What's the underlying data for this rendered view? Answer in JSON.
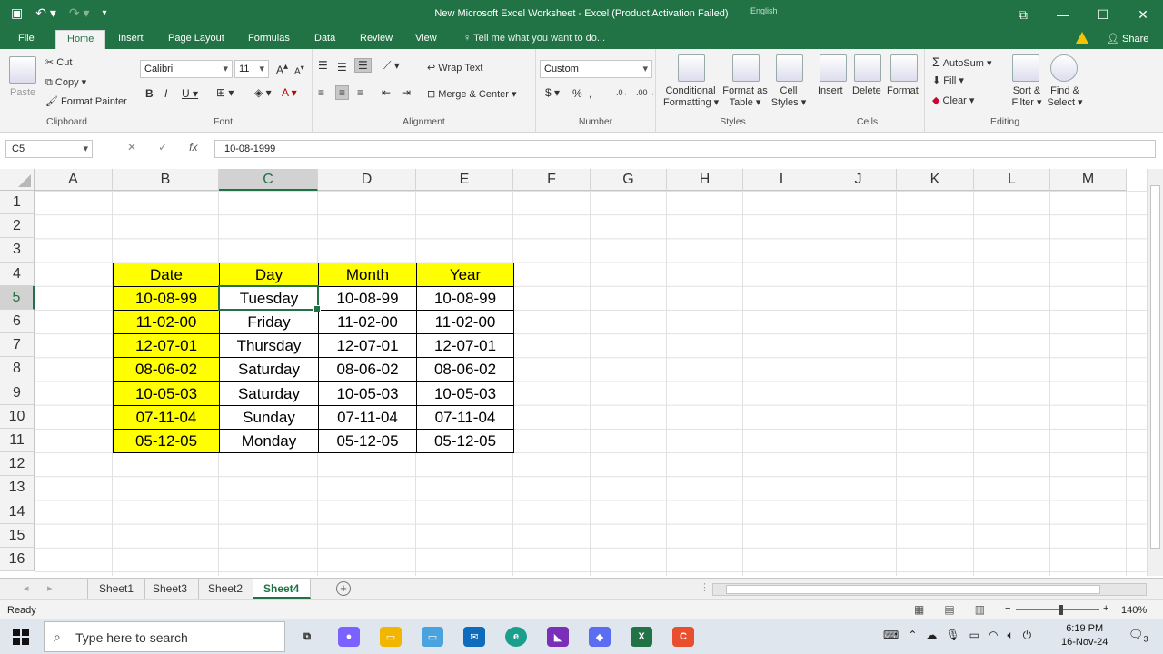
{
  "title": "New Microsoft Excel Worksheet - Excel (Product Activation Failed)",
  "language": "English",
  "ribbon_tabs": [
    "File",
    "Home",
    "Insert",
    "Page Layout",
    "Formulas",
    "Data",
    "Review",
    "View"
  ],
  "tell_me": "Tell me what you want to do...",
  "share": "Share",
  "clipboard": {
    "paste": "Paste",
    "cut": "Cut",
    "copy": "Copy",
    "format_painter": "Format Painter",
    "label": "Clipboard"
  },
  "font": {
    "name": "Calibri",
    "size": "11",
    "label": "Font"
  },
  "alignment": {
    "wrap": "Wrap Text",
    "merge": "Merge & Center",
    "label": "Alignment"
  },
  "number": {
    "format": "Custom",
    "label": "Number"
  },
  "styles": {
    "conditional": "Conditional",
    "conditional2": "Formatting",
    "format_table": "Format as",
    "format_table2": "Table",
    "cell_styles": "Cell",
    "cell_styles2": "Styles",
    "label": "Styles"
  },
  "cells_group": {
    "insert": "Insert",
    "delete": "Delete",
    "format": "Format",
    "label": "Cells"
  },
  "editing": {
    "autosum": "AutoSum",
    "fill": "Fill",
    "clear": "Clear",
    "sort": "Sort &",
    "sort2": "Filter",
    "find": "Find &",
    "find2": "Select",
    "label": "Editing"
  },
  "formula_bar": {
    "name_box": "C5",
    "value": "10-08-1999"
  },
  "columns": [
    "A",
    "B",
    "C",
    "D",
    "E",
    "F",
    "G",
    "H",
    "I",
    "J",
    "K",
    "L",
    "M"
  ],
  "rows": [
    "1",
    "2",
    "3",
    "4",
    "5",
    "6",
    "7",
    "8",
    "9",
    "10",
    "11",
    "12",
    "13",
    "14",
    "15",
    "16"
  ],
  "table": {
    "headers": [
      "Date",
      "Day",
      "Month",
      "Year"
    ],
    "rows": [
      [
        "10-08-99",
        "Tuesday",
        "10-08-99",
        "10-08-99"
      ],
      [
        "11-02-00",
        "Friday",
        "11-02-00",
        "11-02-00"
      ],
      [
        "12-07-01",
        "Thursday",
        "12-07-01",
        "12-07-01"
      ],
      [
        "08-06-02",
        "Saturday",
        "08-06-02",
        "08-06-02"
      ],
      [
        "10-05-03",
        "Saturday",
        "10-05-03",
        "10-05-03"
      ],
      [
        "07-11-04",
        "Sunday",
        "07-11-04",
        "07-11-04"
      ],
      [
        "05-12-05",
        "Monday",
        "05-12-05",
        "05-12-05"
      ]
    ]
  },
  "sheets": [
    "Sheet1",
    "Sheet3",
    "Sheet2",
    "Sheet4"
  ],
  "active_sheet": "Sheet4",
  "status": {
    "ready": "Ready",
    "zoom": "140%"
  },
  "taskbar": {
    "search_placeholder": "Type here to search",
    "time": "6:19 PM",
    "date": "16-Nov-24",
    "notifications": "3"
  },
  "colors": {
    "accent": "#217346",
    "highlight": "#ffff00"
  }
}
